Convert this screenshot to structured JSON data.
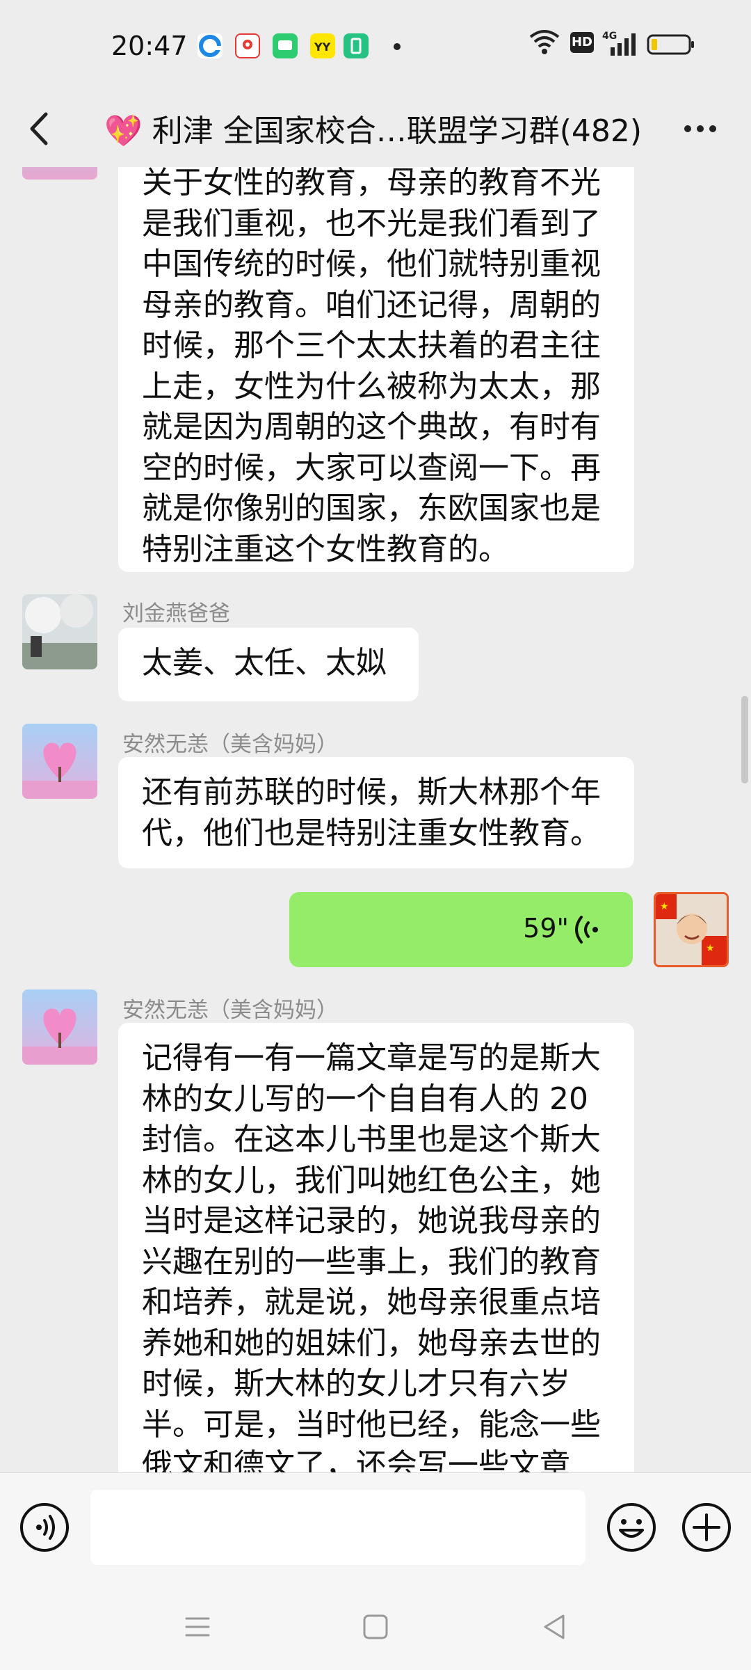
{
  "status_bar": {
    "time": "20:47",
    "network": "4G",
    "hd_label": "HD",
    "icons": [
      "browser-icon",
      "map-icon",
      "chat-app-icon",
      "yy-icon",
      "battery-app-icon"
    ]
  },
  "header": {
    "title": "💖 利津 全国家校合…联盟学习群(482)"
  },
  "messages": [
    {
      "type": "text",
      "lines": [
        "关于女性的教育，母亲的教育不光",
        "是我们重视，也不光是我们看到了",
        "中国传统的时候，他们就特别重视",
        "母亲的教育。咱们还记得，周朝的",
        "时候，那个三个太太扶着的君主往",
        "上走，女性为什么被称为太太，那",
        "就是因为周朝的这个典故，有时有",
        "空的时候，大家可以查阅一下。再",
        "就是你像别的国家，东欧国家也是",
        "特别注重这个女性教育的。"
      ]
    },
    {
      "type": "text",
      "sender": "刘金燕爸爸",
      "lines": [
        "太姜、太任、太姒"
      ]
    },
    {
      "type": "text",
      "sender": "安然无恙（美含妈妈）",
      "lines": [
        "还有前苏联的时候，斯大林那个年",
        "代，他们也是特别注重女性教育。"
      ]
    },
    {
      "type": "voice",
      "self": true,
      "duration": "59\""
    },
    {
      "type": "text",
      "sender": "安然无恙（美含妈妈）",
      "lines": [
        "记得有一有一篇文章是写的是斯大",
        "林的女儿写的一个自自有人的 20",
        "封信。在这本儿书里也是这个斯大",
        "林的女儿，我们叫她红色公主，她",
        "当时是这样记录的，她说我母亲的",
        "兴趣在别的一些事上，我们的教育",
        "和培养，就是说，她母亲很重点培",
        "养她和她的姐妹们，她母亲去世的",
        "时候，斯大林的女儿才只有六岁",
        "半。可是，当时他已经，能念一些",
        "俄文和德文了，还会写一些文章"
      ]
    }
  ],
  "colors": {
    "background": "#ededed",
    "self_bubble": "#95ec69",
    "other_bubble": "#ffffff"
  }
}
